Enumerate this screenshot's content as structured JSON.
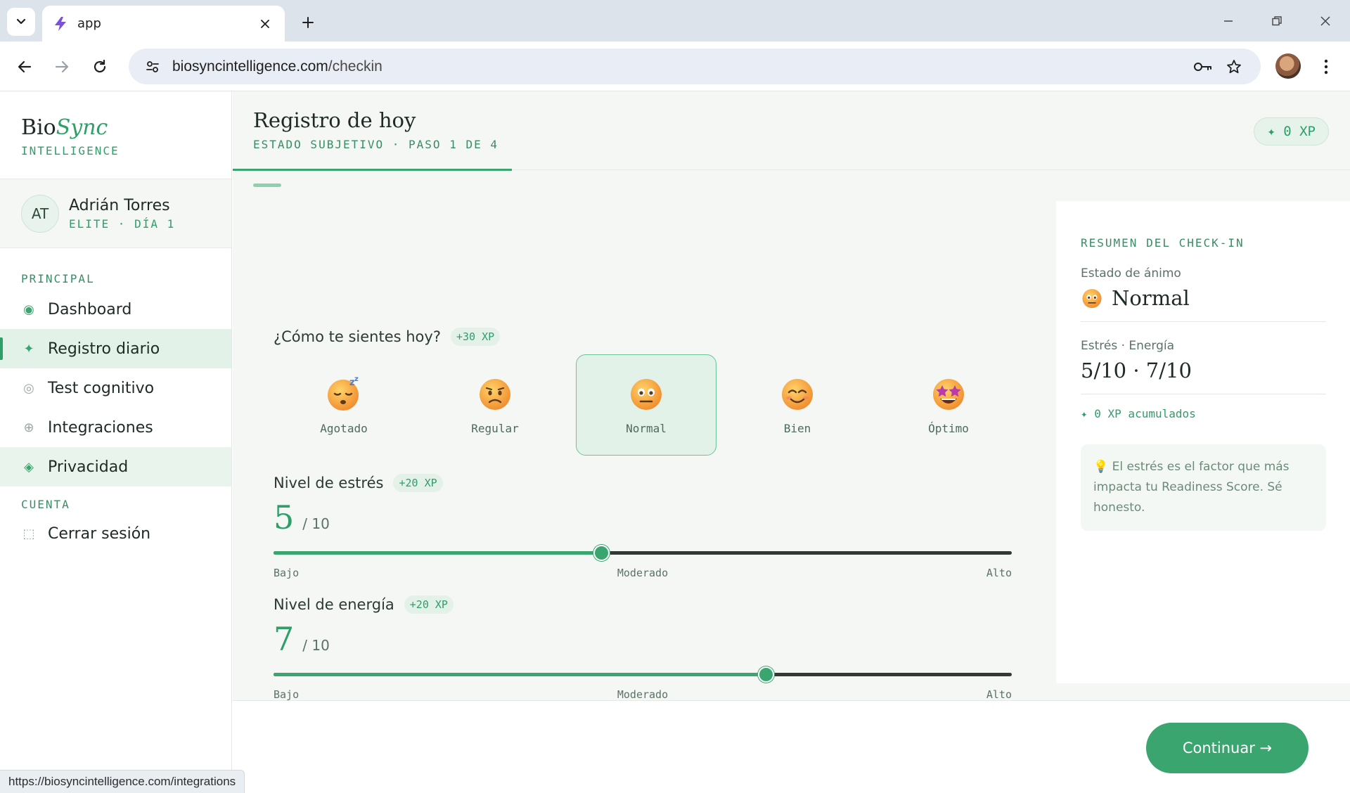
{
  "browser": {
    "tab_title": "app",
    "url_host": "biosyncintelligence.com",
    "url_path": "/checkin",
    "status_url": "https://biosyncintelligence.com/integrations"
  },
  "brand": {
    "name_plain": "Bio",
    "name_accent": "Sync",
    "subtitle": "INTELLIGENCE"
  },
  "user": {
    "initials": "AT",
    "name": "Adrián Torres",
    "meta": "ELITE · DÍA 1"
  },
  "sidebar": {
    "section_main": "PRINCIPAL",
    "items": [
      {
        "label": "Dashboard",
        "icon": "◉"
      },
      {
        "label": "Registro diario",
        "icon": "✦"
      },
      {
        "label": "Test cognitivo",
        "icon": "◎"
      },
      {
        "label": "Integraciones",
        "icon": "⊕"
      },
      {
        "label": "Privacidad",
        "icon": "◈"
      }
    ],
    "section_account": "CUENTA",
    "logout": {
      "label": "Cerrar sesión",
      "icon": "⬚"
    }
  },
  "header": {
    "title": "Registro de hoy",
    "subtitle": "ESTADO SUBJETIVO · PASO 1 DE 4",
    "xp_pill": "✦ 0 XP"
  },
  "mood": {
    "question": "¿Cómo te sientes hoy?",
    "xp": "+30 XP",
    "options": [
      "Agotado",
      "Regular",
      "Normal",
      "Bien",
      "Óptimo"
    ],
    "selected_index": 2
  },
  "stress": {
    "label": "Nivel de estrés",
    "xp": "+20 XP",
    "value": "5",
    "of": "/ 10",
    "level": 0.444,
    "scale": [
      "Bajo",
      "Moderado",
      "Alto"
    ]
  },
  "energy": {
    "label": "Nivel de energía",
    "xp": "+20 XP",
    "value": "7",
    "of": "/ 10",
    "level": 0.667,
    "scale": [
      "Bajo",
      "Moderado",
      "Alto"
    ]
  },
  "summary": {
    "title": "RESUMEN DEL CHECK-IN",
    "mood_label": "Estado de ánimo",
    "mood_value": "Normal",
    "se_label": "Estrés · Energía",
    "se_value": "5/10 · 7/10",
    "xp_line": "✦ 0 XP acumulados",
    "tip_icon": "💡",
    "tip_text": "El estrés es el factor que más impacta tu Readiness Score. Sé honesto."
  },
  "footer": {
    "continue_label": "Continuar →"
  },
  "colors": {
    "accent": "#3aa56f",
    "accent_dark": "#2f9e68",
    "surface": "#f4f7f4"
  }
}
